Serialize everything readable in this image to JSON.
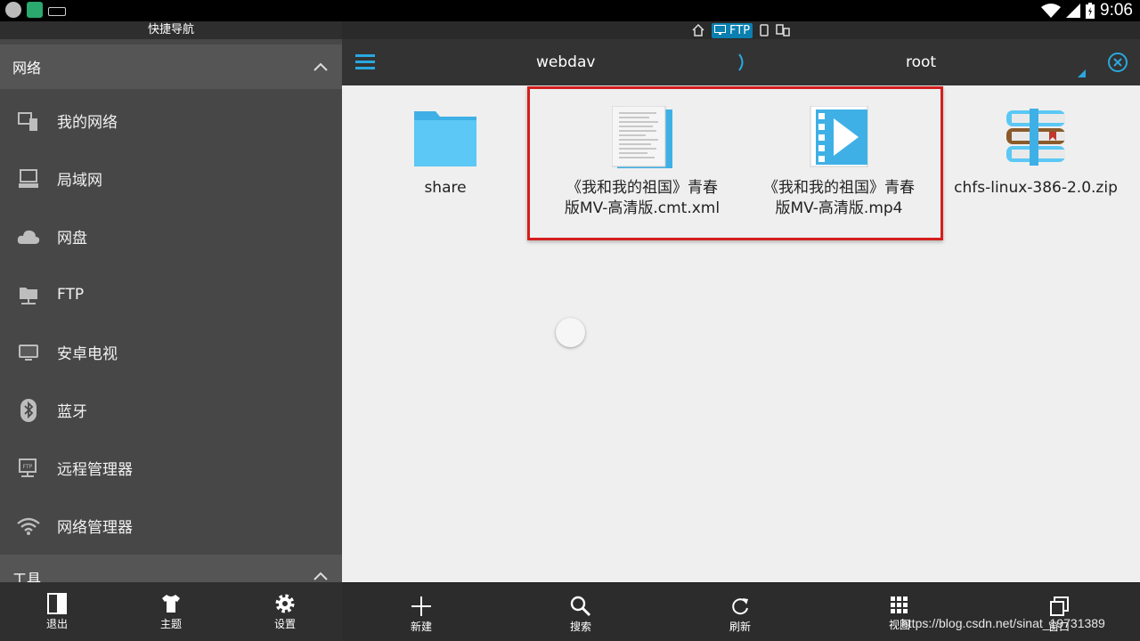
{
  "statusbar": {
    "time": "9:06"
  },
  "drawer": {
    "title": "快捷导航",
    "network_group": "网络",
    "items": [
      {
        "label": "我的网络",
        "icon": "my-network-icon"
      },
      {
        "label": "局域网",
        "icon": "lan-computer-icon"
      },
      {
        "label": "网盘",
        "icon": "cloud-icon"
      },
      {
        "label": "FTP",
        "icon": "ftp-folder-icon"
      },
      {
        "label": "安卓电视",
        "icon": "tv-monitor-icon"
      },
      {
        "label": "蓝牙",
        "icon": "bluetooth-icon"
      },
      {
        "label": "远程管理器",
        "icon": "remote-ftp-icon"
      },
      {
        "label": "网络管理器",
        "icon": "wifi-manager-icon"
      }
    ],
    "tools_group": "工具",
    "bottom": {
      "exit": "退出",
      "theme": "主题",
      "settings": "设置"
    }
  },
  "location_tabs": {
    "ftp": "FTP"
  },
  "breadcrumb": {
    "first": "webdav",
    "second": "root"
  },
  "files": [
    {
      "name": "share",
      "type": "folder"
    },
    {
      "name": "《我和我的祖国》青春版MV-高清版.cmt.xml",
      "type": "document"
    },
    {
      "name": "《我和我的祖国》青春版MV-高清版.mp4",
      "type": "video"
    },
    {
      "name": "chfs-linux-386-2.0.zip",
      "type": "archive"
    }
  ],
  "file_lines": {
    "xml": [
      "《我和我的祖国》青春",
      "版MV-高清版.cmt.xml"
    ],
    "mp4": [
      "《我和我的祖国》青春",
      "版MV-高清版.mp4"
    ]
  },
  "toolbar": {
    "new": "新建",
    "search": "搜索",
    "refresh": "刷新",
    "view": "视图",
    "window": "窗口"
  },
  "watermark": "https://blog.csdn.net/sinat_19731389",
  "colors": {
    "accent": "#29a8e0",
    "highlight_box": "#d51e1e",
    "folder": "#5bc8f5"
  }
}
